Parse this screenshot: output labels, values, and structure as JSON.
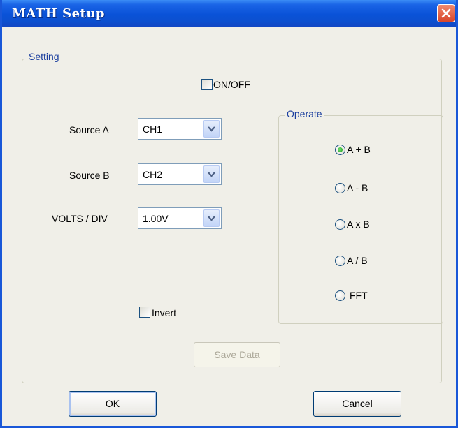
{
  "window": {
    "title": "MATH Setup",
    "close_icon": "close-icon"
  },
  "setting": {
    "legend": "Setting",
    "onoff_label": "ON/OFF",
    "onoff_checked": false,
    "source_a": {
      "label": "Source A",
      "value": "CH1"
    },
    "source_b": {
      "label": "Source B",
      "value": "CH2"
    },
    "volts_div": {
      "label": "VOLTS / DIV",
      "value": "1.00V"
    },
    "invert_label": "Invert",
    "invert_checked": false,
    "save_data_label": "Save Data"
  },
  "operate": {
    "legend": "Operate",
    "options": [
      {
        "label": "A + B",
        "selected": true
      },
      {
        "label": "A - B",
        "selected": false
      },
      {
        "label": "A x B",
        "selected": false
      },
      {
        "label": "A / B",
        "selected": false
      },
      {
        "label": "FFT",
        "selected": false
      }
    ]
  },
  "buttons": {
    "ok": "OK",
    "cancel": "Cancel"
  },
  "colors": {
    "titlebar": "#0a52d8",
    "close": "#d8452a",
    "legend_text": "#1a3e9e",
    "radio_selected": "#1e9a1e",
    "window_bg": "#f0efe8"
  }
}
